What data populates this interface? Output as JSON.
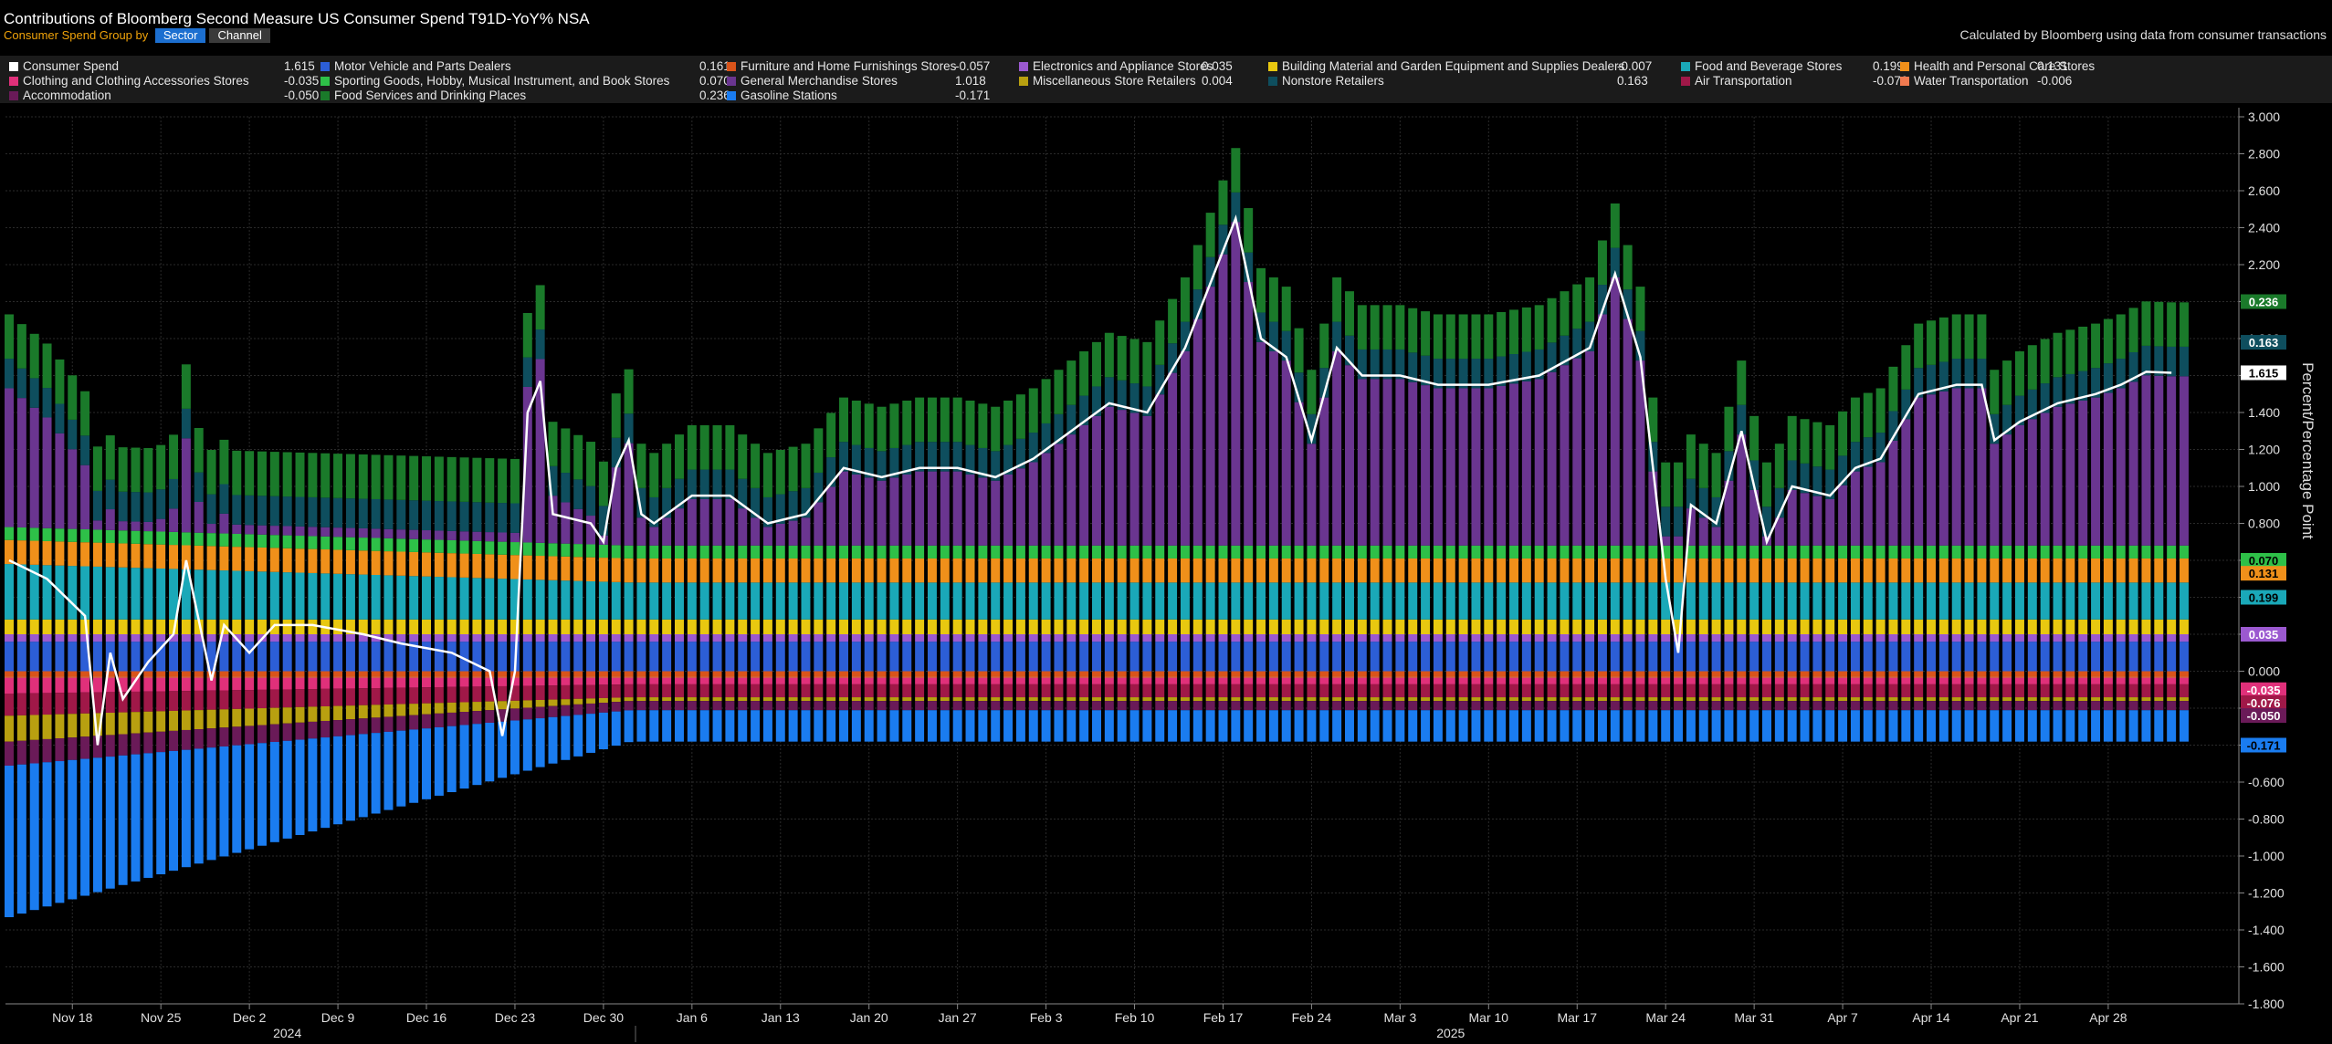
{
  "header": {
    "title": "Contributions of Bloomberg Second Measure US Consumer Spend T91D-YoY% NSA",
    "controls_label": "Consumer Spend  Group by",
    "group_by_options": [
      "Sector",
      "Channel"
    ],
    "group_by_selected": "Sector",
    "credit": "Calculated by Bloomberg using data from consumer transactions"
  },
  "legend": [
    {
      "name": "Consumer Spend",
      "value": "1.615",
      "color": "#ffffff"
    },
    {
      "name": "Motor Vehicle and Parts Dealers",
      "value": "0.161",
      "color": "#2c5ed6"
    },
    {
      "name": "Furniture and Home Furnishings Stores",
      "value": "-0.057",
      "color": "#d9541a"
    },
    {
      "name": "Electronics and Appliance Stores",
      "value": "0.035",
      "color": "#9b59d0"
    },
    {
      "name": "Building Material and Garden Equipment and Supplies Dealers",
      "value": "-0.007",
      "color": "#e8c810"
    },
    {
      "name": "Food and Beverage Stores",
      "value": "0.199",
      "color": "#1aa8b8"
    },
    {
      "name": "Health and Personal Care Stores",
      "value": "0.131",
      "color": "#f0901a"
    },
    {
      "name": "Clothing and Clothing Accessories Stores",
      "value": "-0.035",
      "color": "#e0307a"
    },
    {
      "name": "Sporting Goods, Hobby, Musical Instrument, and Book Stores",
      "value": "0.070",
      "color": "#2ec048"
    },
    {
      "name": "General Merchandise Stores",
      "value": "1.018",
      "color": "#6a3590"
    },
    {
      "name": "Miscellaneous Store Retailers",
      "value": "0.004",
      "color": "#b8a010"
    },
    {
      "name": "Nonstore Retailers",
      "value": "0.163",
      "color": "#0e4e5e"
    },
    {
      "name": "Air Transportation",
      "value": "-0.076",
      "color": "#a01848"
    },
    {
      "name": "Water Transportation",
      "value": "-0.006",
      "color": "#f07a50"
    },
    {
      "name": "Accommodation",
      "value": "-0.050",
      "color": "#6a1a58"
    },
    {
      "name": "Food Services and Drinking Places",
      "value": "0.236",
      "color": "#1a7a2a"
    },
    {
      "name": "Gasoline Stations",
      "value": "-0.171",
      "color": "#1a7cf0"
    }
  ],
  "right_tags": [
    {
      "label": "0.236",
      "value": 2.0,
      "bg": "#1a7a2a",
      "fg": "#ffffff"
    },
    {
      "label": "0.163",
      "value": 1.78,
      "bg": "#0e4e5e",
      "fg": "#ffffff"
    },
    {
      "label": "1.615",
      "value": 1.615,
      "bg": "#ffffff",
      "fg": "#000000"
    },
    {
      "label": "0.070",
      "value": 0.6,
      "bg": "#2ec048",
      "fg": "#000000"
    },
    {
      "label": "0.131",
      "value": 0.53,
      "bg": "#f0901a",
      "fg": "#000000"
    },
    {
      "label": "0.199",
      "value": 0.4,
      "bg": "#1aa8b8",
      "fg": "#000000"
    },
    {
      "label": "0.035",
      "value": 0.2,
      "bg": "#9b59d0",
      "fg": "#ffffff"
    },
    {
      "label": "-0.035",
      "value": -0.1,
      "bg": "#e0307a",
      "fg": "#ffffff"
    },
    {
      "label": "-0.076",
      "value": -0.17,
      "bg": "#a01848",
      "fg": "#ffffff"
    },
    {
      "label": "-0.050",
      "value": -0.24,
      "bg": "#6a1a58",
      "fg": "#ffffff"
    },
    {
      "label": "-0.171",
      "value": -0.4,
      "bg": "#1a7cf0",
      "fg": "#000000"
    }
  ],
  "chart_data": {
    "type": "bar",
    "stacked": true,
    "ylabel": "Percent/Percentage Point",
    "ylim": [
      -1.8,
      3.0
    ],
    "yticks": [
      "3.000",
      "2.800",
      "2.600",
      "2.400",
      "2.200",
      "2.000",
      "1.800",
      "1.600",
      "1.400",
      "1.200",
      "1.000",
      "0.800",
      "0.600",
      "0.400",
      "0.200",
      "0.000",
      "-0.200",
      "-0.400",
      "-0.600",
      "-0.800",
      "-1.000",
      "-1.200",
      "-1.400",
      "-1.600",
      "-1.800"
    ],
    "x_start": "2024-11-13",
    "x_end": "2025-05-04",
    "x_tick_labels": [
      "Nov 18",
      "Nov 25",
      "Dec 2",
      "Dec 9",
      "Dec 16",
      "Dec 23",
      "Dec 30",
      "Jan 6",
      "Jan 13",
      "Jan 20",
      "Jan 27",
      "Feb 3",
      "Feb 10",
      "Feb 17",
      "Feb 24",
      "Mar 3",
      "Mar 10",
      "Mar 17",
      "Mar 24",
      "Mar 31",
      "Apr 7",
      "Apr 14",
      "Apr 21",
      "Apr 28"
    ],
    "year_labels": [
      {
        "label": "2024",
        "date": "2024-12-05"
      },
      {
        "label": "2025",
        "date": "2025-03-07"
      }
    ],
    "grid": true,
    "total_series": {
      "name": "Consumer Spend",
      "color": "#ffffff",
      "points": [
        [
          "2024-11-13",
          0.6
        ],
        [
          "2024-11-16",
          0.5
        ],
        [
          "2024-11-19",
          0.3
        ],
        [
          "2024-11-20",
          -0.4
        ],
        [
          "2024-11-21",
          0.1
        ],
        [
          "2024-11-22",
          -0.15
        ],
        [
          "2024-11-24",
          0.05
        ],
        [
          "2024-11-26",
          0.2
        ],
        [
          "2024-11-27",
          0.6
        ],
        [
          "2024-11-29",
          -0.05
        ],
        [
          "2024-11-30",
          0.25
        ],
        [
          "2024-12-02",
          0.1
        ],
        [
          "2024-12-04",
          0.25
        ],
        [
          "2024-12-07",
          0.25
        ],
        [
          "2024-12-11",
          0.2
        ],
        [
          "2024-12-14",
          0.15
        ],
        [
          "2024-12-18",
          0.1
        ],
        [
          "2024-12-21",
          0.0
        ],
        [
          "2024-12-22",
          -0.35
        ],
        [
          "2024-12-23",
          0.0
        ],
        [
          "2024-12-24",
          1.4
        ],
        [
          "2024-12-25",
          1.57
        ],
        [
          "2024-12-26",
          0.85
        ],
        [
          "2024-12-29",
          0.8
        ],
        [
          "2024-12-30",
          0.7
        ],
        [
          "2024-12-31",
          1.1
        ],
        [
          "2025-01-01",
          1.25
        ],
        [
          "2025-01-02",
          0.85
        ],
        [
          "2025-01-03",
          0.8
        ],
        [
          "2025-01-06",
          0.95
        ],
        [
          "2025-01-09",
          0.95
        ],
        [
          "2025-01-12",
          0.8
        ],
        [
          "2025-01-15",
          0.85
        ],
        [
          "2025-01-18",
          1.1
        ],
        [
          "2025-01-21",
          1.05
        ],
        [
          "2025-01-24",
          1.1
        ],
        [
          "2025-01-27",
          1.1
        ],
        [
          "2025-01-30",
          1.05
        ],
        [
          "2025-02-02",
          1.15
        ],
        [
          "2025-02-05",
          1.3
        ],
        [
          "2025-02-08",
          1.45
        ],
        [
          "2025-02-11",
          1.4
        ],
        [
          "2025-02-14",
          1.75
        ],
        [
          "2025-02-16",
          2.1
        ],
        [
          "2025-02-18",
          2.45
        ],
        [
          "2025-02-20",
          1.8
        ],
        [
          "2025-02-22",
          1.7
        ],
        [
          "2025-02-24",
          1.25
        ],
        [
          "2025-02-26",
          1.75
        ],
        [
          "2025-02-28",
          1.6
        ],
        [
          "2025-03-03",
          1.6
        ],
        [
          "2025-03-06",
          1.55
        ],
        [
          "2025-03-10",
          1.55
        ],
        [
          "2025-03-14",
          1.6
        ],
        [
          "2025-03-18",
          1.75
        ],
        [
          "2025-03-20",
          2.15
        ],
        [
          "2025-03-22",
          1.7
        ],
        [
          "2025-03-24",
          0.5
        ],
        [
          "2025-03-25",
          0.1
        ],
        [
          "2025-03-26",
          0.9
        ],
        [
          "2025-03-28",
          0.8
        ],
        [
          "2025-03-30",
          1.3
        ],
        [
          "2025-04-01",
          0.7
        ],
        [
          "2025-04-03",
          1.0
        ],
        [
          "2025-04-06",
          0.95
        ],
        [
          "2025-04-08",
          1.1
        ],
        [
          "2025-04-10",
          1.15
        ],
        [
          "2025-04-13",
          1.5
        ],
        [
          "2025-04-16",
          1.55
        ],
        [
          "2025-04-18",
          1.55
        ],
        [
          "2025-04-19",
          1.25
        ],
        [
          "2025-04-21",
          1.35
        ],
        [
          "2025-04-24",
          1.45
        ],
        [
          "2025-04-27",
          1.5
        ],
        [
          "2025-04-29",
          1.55
        ],
        [
          "2025-05-01",
          1.62
        ],
        [
          "2025-05-03",
          1.615
        ]
      ]
    }
  }
}
